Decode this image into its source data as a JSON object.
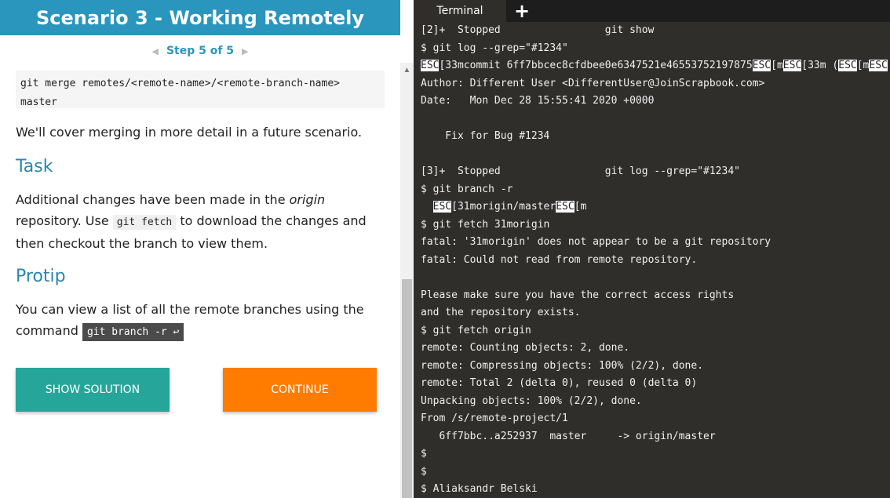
{
  "header": {
    "title": "Scenario 3 - Working Remotely"
  },
  "stepnav": {
    "prev": "◀",
    "label": "Step 5 of 5",
    "next": "▶"
  },
  "code_block": {
    "line1": "git merge remotes/<remote-name>/<remote-branch-name>",
    "line2": "master"
  },
  "content": {
    "p1": "We'll cover merging in more detail in a future scenario.",
    "task_heading": "Task",
    "p2_a": "Additional changes have been made in the ",
    "p2_em": "origin",
    "p2_b": " repository. Use ",
    "p2_code": "git fetch",
    "p2_c": " to download the changes and then checkout the branch to view them.",
    "protip_heading": "Protip",
    "p3_a": "You can view a list of all the remote branches using the command ",
    "p3_code": "git branch -r ↩"
  },
  "buttons": {
    "show_solution": "SHOW SOLUTION",
    "continue": "CONTINUE"
  },
  "terminal": {
    "tab_label": "Terminal",
    "add_tab": "+",
    "esc": "ESC",
    "lines": {
      "l1": "[2]+  Stopped                 git show",
      "l2": "$ git log --grep=\"#1234\"",
      "l3_a": "[33mcommit 6ff7bbcec8cfdbee0e6347521e46553752197875",
      "l3_b": "[m",
      "l3_c": "[33m (",
      "l3_d": "[m",
      "l4": "Author: Different User <DifferentUser@JoinScrapbook.com>",
      "l5": "Date:   Mon Dec 28 15:55:41 2020 +0000",
      "l6": "",
      "l7": "    Fix for Bug #1234",
      "l8": "",
      "l9": "[3]+  Stopped                 git log --grep=\"#1234\"",
      "l10": "$ git branch -r",
      "l11_a": "[31morigin/master",
      "l11_b": "[m",
      "l12": "$ git fetch 31morigin",
      "l13": "fatal: '31morigin' does not appear to be a git repository",
      "l14": "fatal: Could not read from remote repository.",
      "l15": "",
      "l16": "Please make sure you have the correct access rights",
      "l17": "and the repository exists.",
      "l18": "$ git fetch origin",
      "l19": "remote: Counting objects: 2, done.",
      "l20": "remote: Compressing objects: 100% (2/2), done.",
      "l21": "remote: Total 2 (delta 0), reused 0 (delta 0)",
      "l22": "Unpacking objects: 100% (2/2), done.",
      "l23": "From /s/remote-project/1",
      "l24": "   6ff7bbc..a252937  master     -> origin/master",
      "l25": "$",
      "l26": "$",
      "l27": "$ Aliaksandr Belski"
    }
  },
  "colors": {
    "header_bg": "#2a95bd",
    "heading": "#2a86ae",
    "show_solution_bg": "#26a69a",
    "continue_bg": "#ff7c00",
    "terminal_bg": "#302e2b",
    "tabbar_bg": "#1d1d1d"
  }
}
